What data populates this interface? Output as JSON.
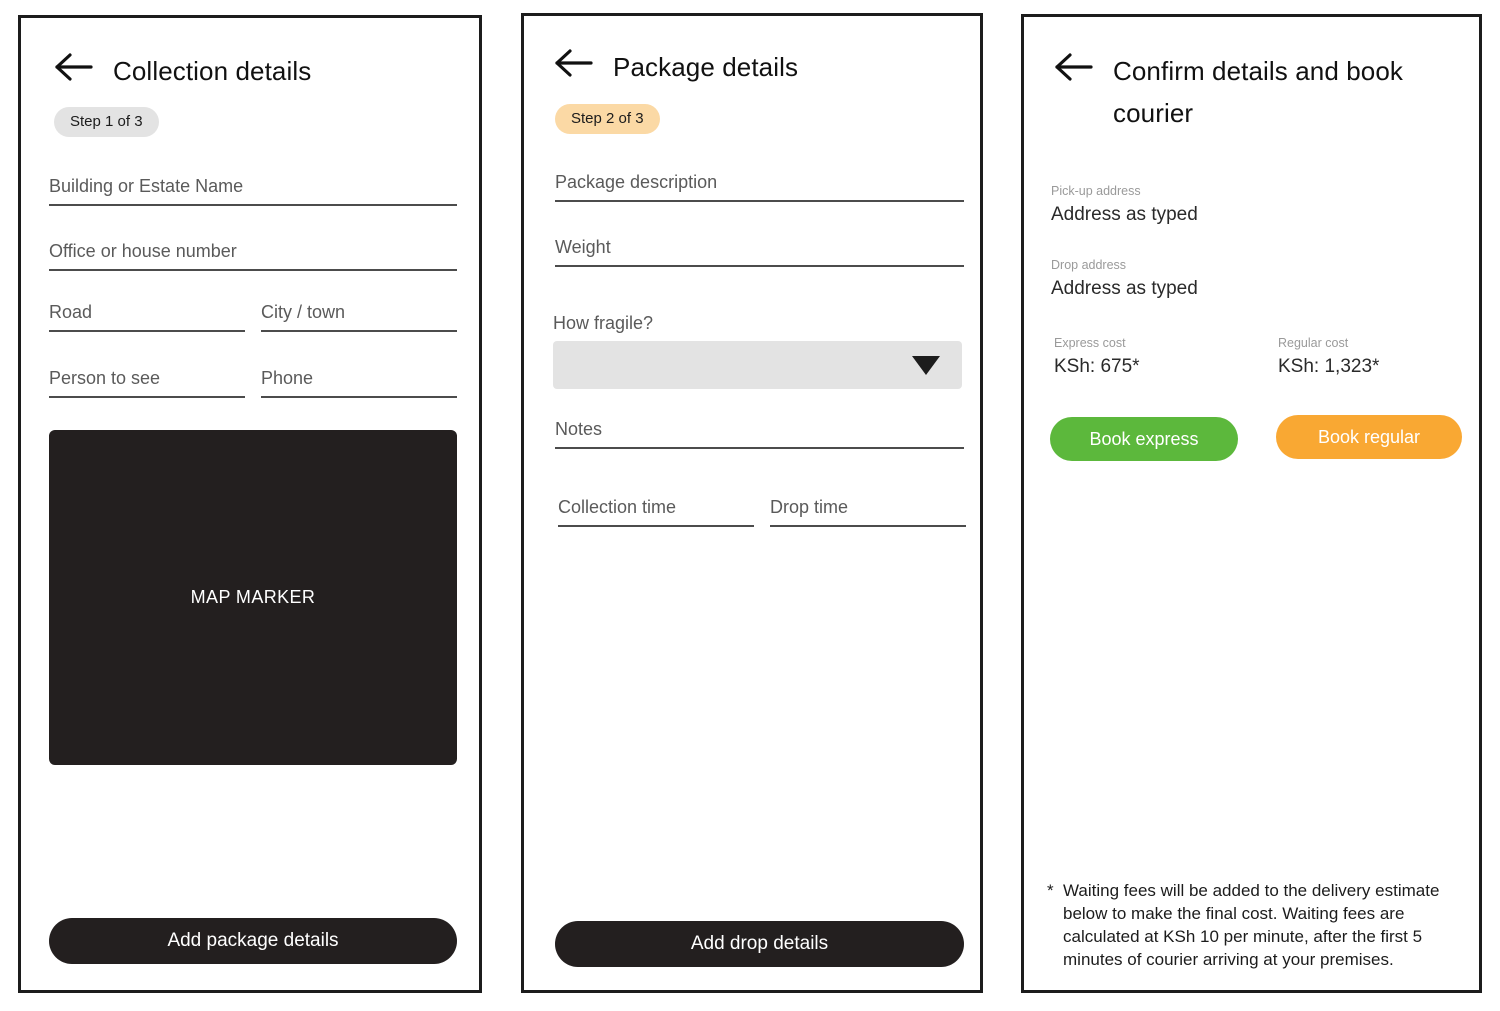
{
  "screens": [
    {
      "id": "collection-details",
      "back_icon": "back-arrow-icon",
      "title": "Collection details",
      "step_badge": "Step 1 of 3",
      "step_badge_color": "#e3e3e3",
      "fields": [
        {
          "label": "Building or Estate Name",
          "value": ""
        },
        {
          "label": "Office or house number",
          "value": ""
        },
        {
          "label": "Road",
          "value": ""
        },
        {
          "label": "City / town",
          "value": ""
        },
        {
          "label": "Person to see",
          "value": ""
        },
        {
          "label": "Phone",
          "value": ""
        }
      ],
      "map_placeholder": "MAP MARKER",
      "map_color": "#231f1f",
      "primary_button": "Add package details"
    },
    {
      "id": "package-details",
      "back_icon": "back-arrow-icon",
      "title": "Package details",
      "step_badge": "Step 2 of 3",
      "step_badge_color": "#fbd9a5",
      "fields": [
        {
          "label": "Package description",
          "value": ""
        },
        {
          "label": "Weight",
          "value": ""
        },
        {
          "label": "Notes",
          "value": ""
        },
        {
          "label": "Collection time",
          "value": ""
        },
        {
          "label": "Drop time",
          "value": ""
        }
      ],
      "select": {
        "label": "How fragile?",
        "selected": "",
        "caret_icon": "chevron-down-icon",
        "background": "#e3e3e3"
      },
      "primary_button": "Add drop details"
    },
    {
      "id": "confirm-and-book",
      "back_icon": "back-arrow-icon",
      "title": "Confirm details and book courier",
      "summary": [
        {
          "caption": "Pick-up address",
          "value": "Address as typed"
        },
        {
          "caption": "Drop address",
          "value": "Address as typed"
        }
      ],
      "costs": [
        {
          "caption": "Express cost",
          "value": "KSh: 675*"
        },
        {
          "caption": "Regular cost",
          "value": "KSh: 1,323*"
        }
      ],
      "buttons": [
        {
          "label": "Book express",
          "color": "#5cb83c"
        },
        {
          "label": "Book regular",
          "color": "#f9a833"
        }
      ],
      "footnote_star": "*",
      "footnote": "Waiting fees will be added to the delivery estimate below to make the final cost. Waiting fees are calculated at KSh 10 per minute, after the first 5 minutes of courier arriving at your premises."
    }
  ]
}
